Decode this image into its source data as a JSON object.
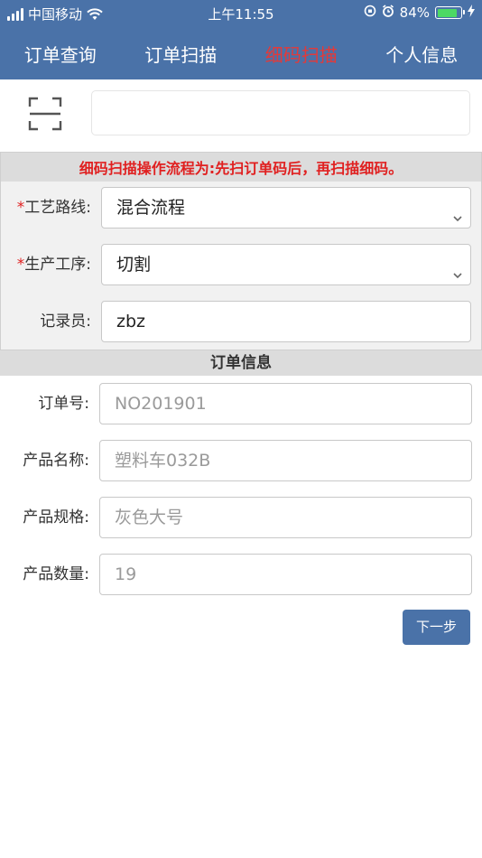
{
  "status_bar": {
    "carrier": "中国移动",
    "time": "上午11:55",
    "battery_percent": "84%",
    "battery_level": 0.84
  },
  "nav": {
    "tabs": [
      {
        "label": "订单查询",
        "active": false
      },
      {
        "label": "订单扫描",
        "active": false
      },
      {
        "label": "细码扫描",
        "active": true
      },
      {
        "label": "个人信息",
        "active": false
      }
    ],
    "active_color": "#e23a3a",
    "bar_color": "#4a72a8"
  },
  "scan": {
    "input_value": "",
    "icon": "scan-icon"
  },
  "notice": "细码扫描操作流程为:先扫订单码后，再扫描细码。",
  "form": {
    "process_route": {
      "label": "工艺路线:",
      "required_mark": "*",
      "value": "混合流程"
    },
    "production_step": {
      "label": "生产工序:",
      "required_mark": "*",
      "value": "切割"
    },
    "recorder": {
      "label": "记录员:",
      "value": "zbz"
    }
  },
  "order_info": {
    "header": "订单信息",
    "order_no": {
      "label": "订单号:",
      "value": "NO201901"
    },
    "product_name": {
      "label": "产品名称:",
      "value": "塑料车032B"
    },
    "product_spec": {
      "label": "产品规格:",
      "value": "灰色大号"
    },
    "product_qty": {
      "label": "产品数量:",
      "value": "19"
    }
  },
  "next_button": "下一步"
}
